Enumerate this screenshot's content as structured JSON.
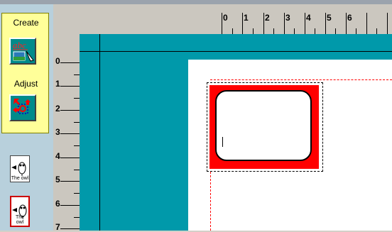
{
  "toolbox": {
    "create_label": "Create",
    "adjust_label": "Adjust",
    "create_icon": "text-picture-create-icon",
    "adjust_icon": "adjust-arrows-icon"
  },
  "pages": [
    {
      "caption": "The owl",
      "selected": false
    },
    {
      "caption": "The owl",
      "selected": true
    }
  ],
  "ruler": {
    "horizontal": [
      "0",
      "1",
      "2",
      "3",
      "4",
      "5",
      "6"
    ],
    "vertical": [
      "0",
      "1",
      "2",
      "3",
      "4",
      "5",
      "6",
      "7"
    ]
  },
  "colors": {
    "canvas": "#0099aa",
    "card_border": "#ff0000",
    "panel": "#ffff99",
    "guides": "#ff0000"
  }
}
